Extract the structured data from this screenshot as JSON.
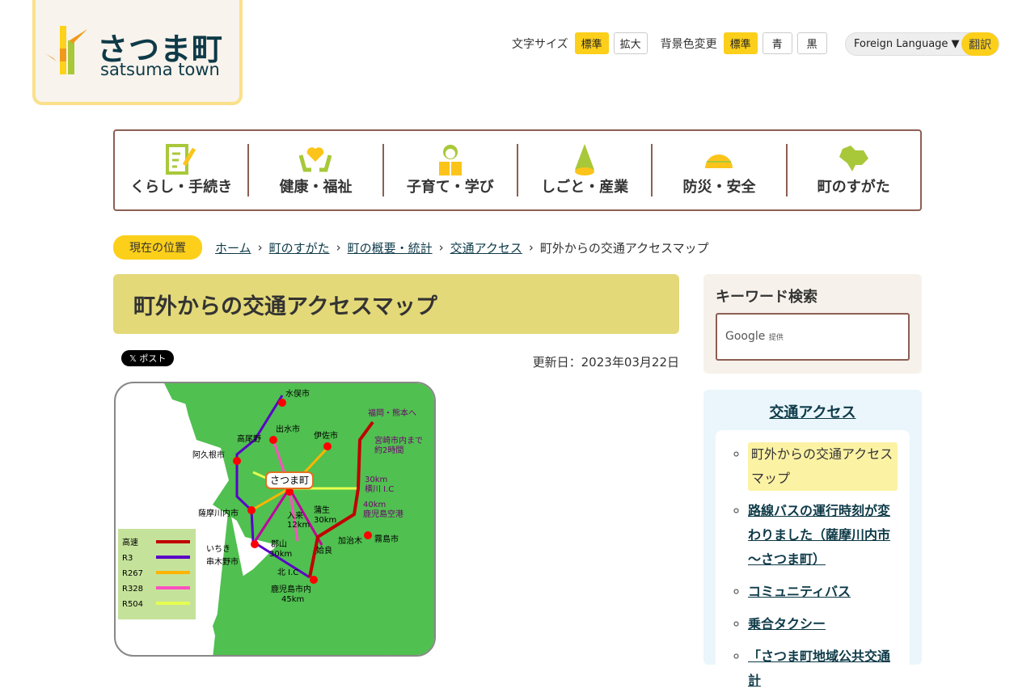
{
  "logo": {
    "jp": "さつま町",
    "en": "satsuma town"
  },
  "tools": {
    "font_label": "文字サイズ",
    "font_std": "標準",
    "font_large": "拡大",
    "bg_label": "背景色変更",
    "bg_std": "標準",
    "bg_blue": "青",
    "bg_black": "黒"
  },
  "lang": {
    "label": "Foreign Language ▼",
    "translate": "翻訳"
  },
  "nav": [
    {
      "label": "くらし・手続き"
    },
    {
      "label": "健康・福祉"
    },
    {
      "label": "子育て・学び"
    },
    {
      "label": "しごと・産業"
    },
    {
      "label": "防災・安全"
    },
    {
      "label": "町のすがた"
    }
  ],
  "breadcrumb": {
    "here": "現在の位置",
    "items": [
      "ホーム",
      "町のすがた",
      "町の概要・統計",
      "交通アクセス"
    ],
    "current": "町外からの交通アクセスマップ",
    "sep": "›"
  },
  "page": {
    "title": "町外からの交通アクセスマップ",
    "post": "𝕏 ポスト",
    "updated": "更新日：2023年03月22日"
  },
  "map": {
    "center": "さつま町",
    "labels": [
      "水俣市",
      "出水市",
      "伊佐市",
      "高尾野",
      "阿久根市",
      "薩摩川内市",
      "入来",
      "12km",
      "蒲生",
      "30km",
      "郡山",
      "30km",
      "いちき",
      "串木野市",
      "姶良",
      "加治木",
      "霧島市",
      "北 I.C",
      "鹿児島市内",
      "45km",
      "30km",
      "横川 I.C",
      "40km",
      "鹿児島空港",
      "福岡・熊本へ",
      "宮崎市内まで",
      "約2時間"
    ],
    "legend": [
      {
        "name": "高速",
        "color": "#c00000"
      },
      {
        "name": "R3",
        "color": "#5a00c8"
      },
      {
        "name": "R267",
        "color": "#ffb400"
      },
      {
        "name": "R328",
        "color": "#ff50c0"
      },
      {
        "name": "R504",
        "color": "#e6ff50"
      }
    ]
  },
  "search": {
    "title": "キーワード検索",
    "brand": "Google",
    "provided": "提供"
  },
  "side": {
    "title": "交通アクセス",
    "items": [
      "町外からの交通アクセスマップ",
      "路線バスの運行時刻が変わりました（薩摩川内市～さつま町）",
      "コミュニティバス",
      "乗合タクシー",
      "「さつま町地域公共交通計"
    ]
  }
}
